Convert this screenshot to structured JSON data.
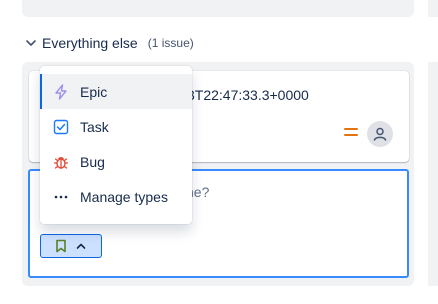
{
  "group": {
    "title": "Everything else",
    "count": "(1 issue)"
  },
  "card": {
    "title": "3T22:47:33.3+0000",
    "priority": "medium",
    "assignee": "unassigned"
  },
  "create": {
    "placeholder": "ne?"
  },
  "dropdown": {
    "items": [
      {
        "label": "Epic",
        "icon": "epic-lightning-icon",
        "selected": true
      },
      {
        "label": "Task",
        "icon": "task-checkbox-icon",
        "selected": false
      },
      {
        "label": "Bug",
        "icon": "bug-icon",
        "selected": false
      },
      {
        "label": "Manage types",
        "icon": "more-dots-icon",
        "selected": false
      }
    ]
  },
  "colors": {
    "epic": "#9f8fef",
    "task": "#1d7afc",
    "bug": "#e34935",
    "priority": "#e2740f",
    "focus": "#388bff",
    "story_icon": "#5b7f24"
  }
}
